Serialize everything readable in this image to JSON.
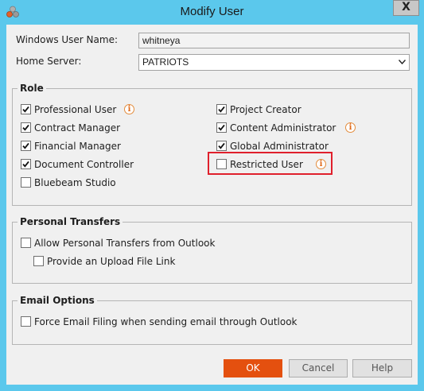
{
  "window": {
    "title": "Modify User",
    "close_glyph": "X"
  },
  "form": {
    "windows_user_name_label": "Windows User Name:",
    "windows_user_name_value": "whitneya",
    "home_server_label": "Home Server:",
    "home_server_value": "PATRIOTS"
  },
  "role": {
    "title": "Role",
    "left": [
      {
        "label": "Professional User",
        "checked": true,
        "info": true
      },
      {
        "label": "Contract Manager",
        "checked": true,
        "info": false
      },
      {
        "label": "Financial Manager",
        "checked": true,
        "info": false
      },
      {
        "label": "Document Controller",
        "checked": true,
        "info": false
      },
      {
        "label": "Bluebeam Studio",
        "checked": false,
        "info": false
      }
    ],
    "right": [
      {
        "label": "Project Creator",
        "checked": true,
        "info": false
      },
      {
        "label": "Content Administrator",
        "checked": true,
        "info": true
      },
      {
        "label": "Global Administrator",
        "checked": true,
        "info": false
      },
      {
        "label": "Restricted User",
        "checked": false,
        "info": true,
        "highlighted": true
      }
    ]
  },
  "personal_transfers": {
    "title": "Personal Transfers",
    "allow_label": "Allow Personal Transfers from Outlook",
    "allow_checked": false,
    "upload_link_label": "Provide an Upload File Link",
    "upload_link_checked": false
  },
  "email_options": {
    "title": "Email Options",
    "force_filing_label": "Force Email Filing when sending email through Outlook",
    "force_filing_checked": false
  },
  "buttons": {
    "ok": "OK",
    "cancel": "Cancel",
    "help": "Help"
  },
  "info_glyph": "i",
  "colors": {
    "title_bar": "#5bc8ec",
    "ok_button": "#e4500f",
    "highlight": "#e0202c",
    "info_icon": "#e06a1a"
  }
}
